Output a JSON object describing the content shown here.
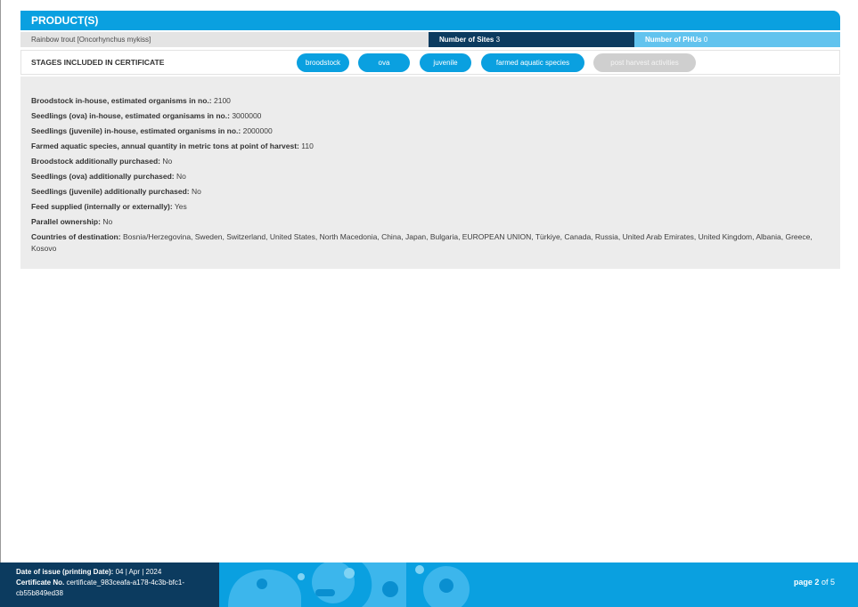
{
  "section_title": "PRODUCT(S)",
  "species": "Rainbow trout [Oncorhynchus mykiss]",
  "sites": {
    "label": "Number of Sites",
    "value": "3"
  },
  "phus": {
    "label": "Number of PHUs",
    "value": "0"
  },
  "stages": {
    "label": "STAGES INCLUDED IN CERTIFICATE",
    "items": [
      {
        "label": "broodstock",
        "active": true
      },
      {
        "label": "ova",
        "active": true
      },
      {
        "label": "juvenile",
        "active": true
      },
      {
        "label": "farmed aquatic species",
        "active": true
      },
      {
        "label": "post harvest activities",
        "active": false
      }
    ]
  },
  "details": [
    {
      "label": "Broodstock in-house, estimated organisms in no.:",
      "value": "2100"
    },
    {
      "label": "Seedlings (ova) in-house, estimated organisams in no.:",
      "value": "3000000"
    },
    {
      "label": "Seedlings (juvenile) in-house, estimated organisms in no.:",
      "value": "2000000"
    },
    {
      "label": "Farmed aquatic species, annual quantity in metric tons at point of harvest:",
      "value": "110"
    },
    {
      "label": "Broodstock additionally purchased:",
      "value": "No"
    },
    {
      "label": "Seedlings (ova) additionally purchased:",
      "value": "No"
    },
    {
      "label": "Seedlings (juvenile) additionally purchased:",
      "value": "No"
    },
    {
      "label": "Feed supplied (internally or externally):",
      "value": "Yes"
    },
    {
      "label": "Parallel ownership:",
      "value": "No"
    },
    {
      "label": "Countries of destination:",
      "value": "Bosnia/Herzegovina, Sweden, Switzerland, United States, North Macedonia, China, Japan, Bulgaria, EUROPEAN UNION, Türkiye, Canada, Russia, United Arab Emirates, United Kingdom, Albania, Greece, Kosovo"
    }
  ],
  "footer": {
    "issue_label": "Date of issue (printing Date):",
    "issue_value": "04 | Apr | 2024",
    "cert_label": "Certificate No.",
    "cert_value": "certificate_983ceafa-a178-4c3b-bfc1-cb55b849ed38",
    "page_label": "page",
    "page_current": "2",
    "page_sep": "of",
    "page_total": "5"
  },
  "colors": {
    "accent": "#0aa0e0",
    "navy": "#0c3b5f",
    "light_blue": "#62c3ee",
    "inactive_pill": "#cfcfcf",
    "panel": "#ececec"
  }
}
